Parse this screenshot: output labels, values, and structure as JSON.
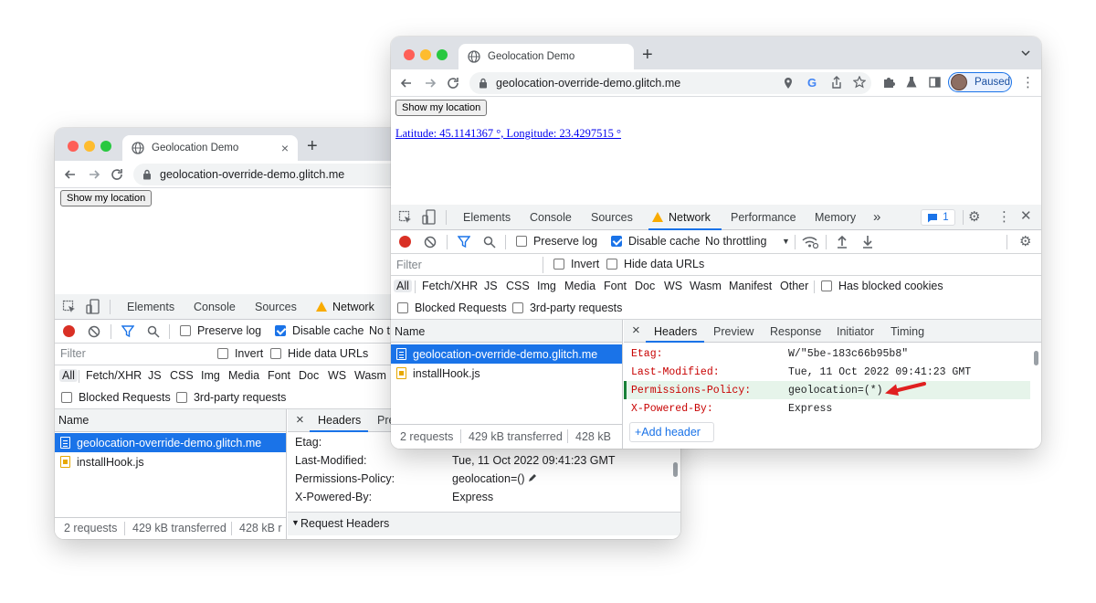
{
  "back_window": {
    "tab_title": "Geolocation Demo",
    "tab_close": "×",
    "new_tab": "+",
    "url": "geolocation-override-demo.glitch.me",
    "page_button": "Show my location",
    "devtools_tabs": [
      "Elements",
      "Console",
      "Sources",
      "Network"
    ],
    "preserve_log": "Preserve log",
    "disable_cache": "Disable cache",
    "throttling_partial": "No t",
    "filter_placeholder": "Filter",
    "invert": "Invert",
    "hide_data_urls": "Hide data URLs",
    "type_filters": [
      "All",
      "Fetch/XHR",
      "JS",
      "CSS",
      "Img",
      "Media",
      "Font",
      "Doc",
      "WS",
      "Wasm"
    ],
    "blocked_requests": "Blocked Requests",
    "third_party": "3rd-party requests",
    "name_header": "Name",
    "requests": [
      "geolocation-override-demo.glitch.me",
      "installHook.js"
    ],
    "status_requests": "2 requests",
    "status_transferred": "429 kB transferred",
    "status_partial": "428 kB r",
    "detail_close": "×",
    "detail_tab_headers": "Headers",
    "detail_tab_partial": "Pre",
    "headers": [
      {
        "name": "Etag:",
        "value": ""
      },
      {
        "name": "Last-Modified:",
        "value": "Tue, 11 Oct 2022 09:41:23 GMT"
      },
      {
        "name": "Permissions-Policy:",
        "value": "geolocation=()"
      },
      {
        "name": "X-Powered-By:",
        "value": "Express"
      }
    ],
    "request_headers": "Request Headers"
  },
  "front_window": {
    "tab_title": "Geolocation Demo",
    "new_tab": "+",
    "url": "geolocation-override-demo.glitch.me",
    "profile_label": "Paused",
    "page_button": "Show my location",
    "location_text": "Latitude: 45.1141367 °, Longitude: 23.4297515 °",
    "devtools_tabs": [
      "Elements",
      "Console",
      "Sources",
      "Network",
      "Performance",
      "Memory"
    ],
    "more_tabs": "»",
    "issues_count": "1",
    "preserve_log": "Preserve log",
    "disable_cache": "Disable cache",
    "throttling": "No throttling",
    "filter_placeholder": "Filter",
    "invert": "Invert",
    "hide_data_urls": "Hide data URLs",
    "type_filters": [
      "All",
      "Fetch/XHR",
      "JS",
      "CSS",
      "Img",
      "Media",
      "Font",
      "Doc",
      "WS",
      "Wasm",
      "Manifest",
      "Other"
    ],
    "has_blocked_cookies": "Has blocked cookies",
    "blocked_requests": "Blocked Requests",
    "third_party": "3rd-party requests",
    "name_header": "Name",
    "requests": [
      "geolocation-override-demo.glitch.me",
      "installHook.js"
    ],
    "status_requests": "2 requests",
    "status_transferred": "429 kB transferred",
    "status_partial": "428 kB",
    "detail_close": "×",
    "detail_tabs": [
      "Headers",
      "Preview",
      "Response",
      "Initiator",
      "Timing"
    ],
    "headers": [
      {
        "name": "Etag:",
        "value": "W/\"5be-183c66b95b8\""
      },
      {
        "name": "Last-Modified:",
        "value": "Tue, 11 Oct 2022 09:41:23 GMT"
      },
      {
        "name": "Permissions-Policy:",
        "value": "geolocation=(*)"
      },
      {
        "name": "X-Powered-By:",
        "value": "Express"
      }
    ],
    "add_header": "+Add header"
  },
  "colors": {
    "accent": "#1a73e8",
    "header_name": "#c80000",
    "arrow": "#e02020",
    "warning": "#f9ab00"
  }
}
